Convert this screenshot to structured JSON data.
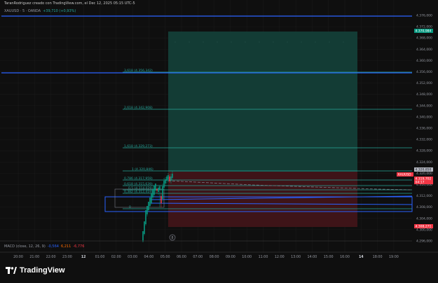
{
  "caption": "TaranRodriguez creado con TradingView.com, el Dec 12, 2025 05:15 UTC-5",
  "symbol_line": {
    "symbol": "XAUUSD · 5 · OANDA",
    "change": "+39,710 (+0,93%)"
  },
  "price_axis": {
    "ticks": [
      "4.376,000",
      "4.372,000",
      "4.368,000",
      "4.364,000",
      "4.360,000",
      "4.356,000",
      "4.352,000",
      "4.348,000",
      "4.344,000",
      "4.340,000",
      "4.336,000",
      "4.332,000",
      "4.328,000",
      "4.324,000",
      "4.320,000",
      "4.316,000",
      "4.312,000",
      "4.308,000",
      "4.304,000",
      "4.300,000",
      "4.296,000"
    ],
    "badges": [
      {
        "text": "4.370,984",
        "color": "#089981",
        "text_color": "#ffffff"
      },
      {
        "text": "4.320,850",
        "color": "#b2b5be",
        "text_color": "#131722"
      },
      {
        "text": "XAUUSD",
        "color": "#f23645",
        "text_color": "#ffffff"
      },
      {
        "text": "4.319,702",
        "color": "#f23645",
        "text_color": "#ffffff"
      },
      {
        "text": "04:17",
        "color": "#f23645",
        "text_color": "#ffffff"
      },
      {
        "text": "4.308,271",
        "color": "#f23645",
        "text_color": "#ffffff"
      }
    ]
  },
  "time_axis": {
    "ticks": [
      "20:00",
      "21:00",
      "22:00",
      "23:00",
      "12",
      "01:00",
      "02:00",
      "03:00",
      "04:00",
      "05:00",
      "06:00",
      "07:00",
      "08:00",
      "09:00",
      "10:00",
      "11:00",
      "12:00",
      "13:00",
      "14:00",
      "15:00",
      "16:00",
      "14",
      "18:00",
      "19:00"
    ],
    "bold_ticks": [
      "12",
      "14"
    ]
  },
  "fib_levels": [
    {
      "text": "3,618 (4.356,342)"
    },
    {
      "text": "2,618 (4.342,908)"
    },
    {
      "text": "1,618 (4.329,273)"
    },
    {
      "text": "1 (4.320,846)"
    },
    {
      "text": "0,786 (4.317,959)"
    },
    {
      "text": "0,618 (4.315,639)"
    },
    {
      "text": "0,5 (4.314,029)"
    },
    {
      "text": "0,382 (4.312,419)"
    },
    {
      "text": "0"
    }
  ],
  "position_tool": {
    "target_price": 4370.984,
    "entry_price": 4320.85,
    "stop_price": 4308.271
  },
  "macd_legend": {
    "label": "MACD (close, 12, 26, 9)",
    "macd": "-0,564",
    "signal": "6,211",
    "hist": "-6,776"
  },
  "brand": "TradingView",
  "colors": {
    "background": "#0f0f0f",
    "grid": "#1c1c1c",
    "target_zone": "#133c35",
    "stop_zone": "#3e1418",
    "fib_line": "#26a69a",
    "trend_line": "#2962ff",
    "candle_up": "#089981",
    "candle_down": "#f23645"
  },
  "icons": {
    "brand_logo": "tradingview-logo-icon",
    "replay_marker": "circled-number-icon"
  },
  "replay_marker": "8"
}
